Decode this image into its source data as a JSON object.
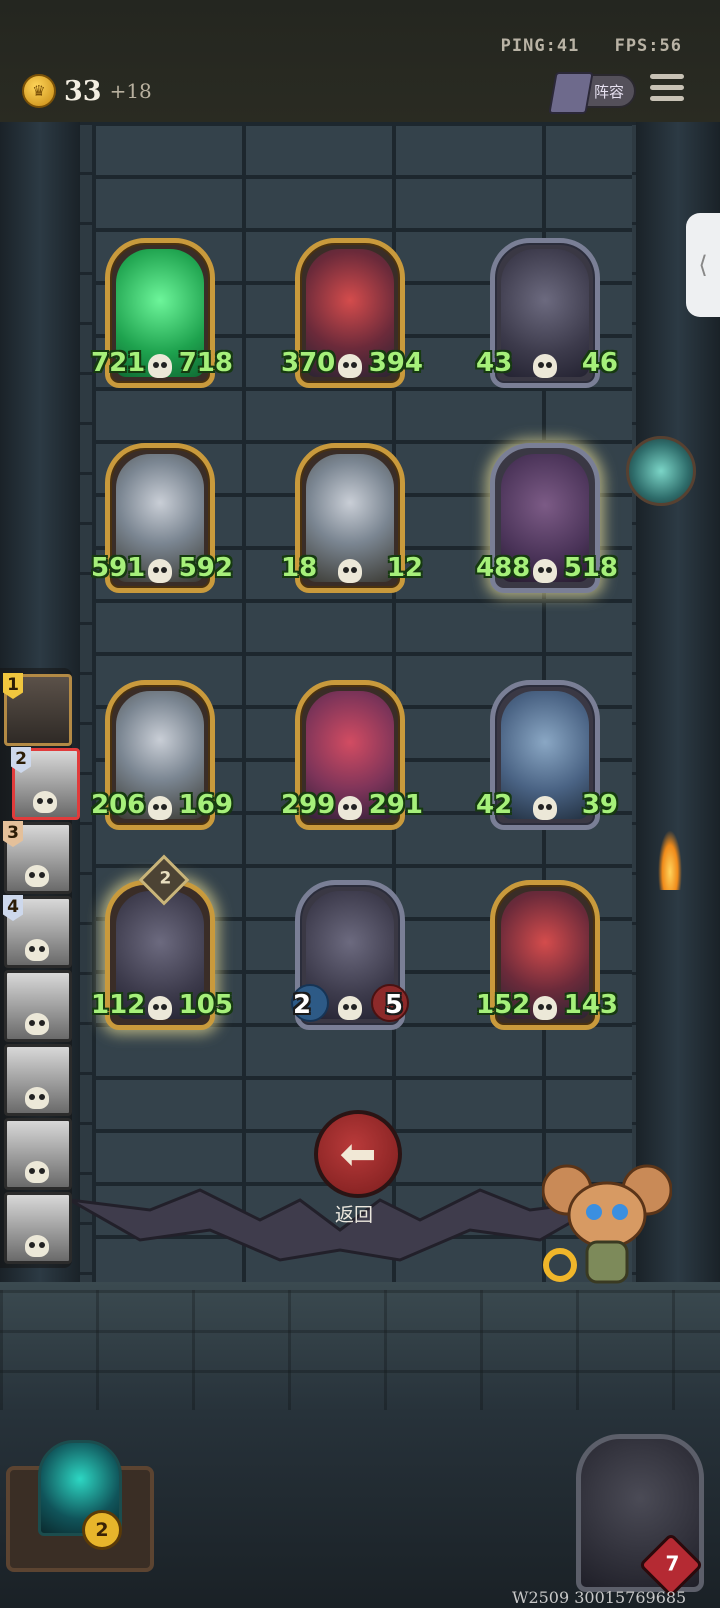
{
  "header": {
    "ping": "PING:41",
    "fps": "FPS:56",
    "gold": "33",
    "gold_bonus": "+18",
    "lineup_label": "阵容"
  },
  "board": {
    "cards": [
      {
        "atk": "721",
        "hp": "718",
        "frame": "gold",
        "portrait": "green-ghost"
      },
      {
        "atk": "370",
        "hp": "394",
        "frame": "gold",
        "portrait": "clown"
      },
      {
        "atk": "43",
        "hp": "46",
        "frame": "silver",
        "portrait": "rat"
      },
      {
        "atk": "591",
        "hp": "592",
        "frame": "gold",
        "portrait": "robot"
      },
      {
        "atk": "18",
        "hp": "12",
        "frame": "gold",
        "portrait": "robot"
      },
      {
        "atk": "488",
        "hp": "518",
        "frame": "silver",
        "portrait": "dark-knight"
      },
      {
        "atk": "206",
        "hp": "169",
        "frame": "gold",
        "portrait": "robot"
      },
      {
        "atk": "299",
        "hp": "291",
        "frame": "gold",
        "portrait": "mech"
      },
      {
        "atk": "42",
        "hp": "39",
        "frame": "silver",
        "portrait": "armor"
      },
      {
        "atk": "112",
        "hp": "105",
        "frame": "gold",
        "portrait": "rat",
        "level": "2"
      },
      {
        "atk": "2",
        "hp": "5",
        "frame": "silver",
        "portrait": "rat"
      },
      {
        "atk": "152",
        "hp": "143",
        "frame": "gold",
        "portrait": "clown"
      }
    ]
  },
  "roster": {
    "players": [
      {
        "rank": "1",
        "selected": false
      },
      {
        "rank": "2",
        "selected": true
      },
      {
        "rank": "3"
      },
      {
        "rank": "4"
      },
      {
        "rank": ""
      },
      {
        "rank": ""
      },
      {
        "rank": ""
      },
      {
        "rank": ""
      }
    ]
  },
  "controls": {
    "back_label": "返回",
    "hero_count": "2",
    "player_hp": "7"
  },
  "footer": {
    "id_text": "W2509 30015769685"
  },
  "colors": {
    "stat_green": "#a6f07a",
    "frame_gold": "#c99a3c",
    "frame_silver": "#7a7f96",
    "back_button": "#9c2b2b"
  }
}
